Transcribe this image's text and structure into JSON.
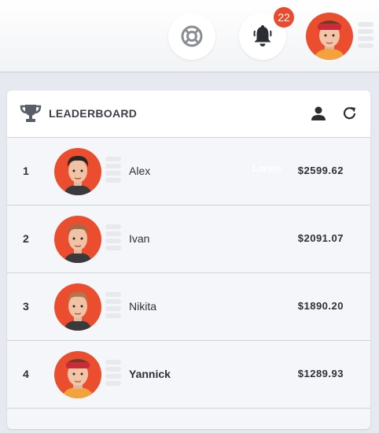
{
  "header": {
    "notification_count": "22",
    "icons": [
      "lifebuoy-icon",
      "bell-icon",
      "user-avatar"
    ]
  },
  "leaderboard": {
    "title": "LEADERBOARD",
    "rows": [
      {
        "rank": "1",
        "name": "Alex",
        "amount": "$2599.62",
        "ghost": "Lorem"
      },
      {
        "rank": "2",
        "name": "Ivan",
        "amount": "$2091.07"
      },
      {
        "rank": "3",
        "name": "Nikita",
        "amount": "$1890.20"
      },
      {
        "rank": "4",
        "name": "Yannick",
        "amount": "$1289.93"
      }
    ]
  },
  "colors": {
    "accent": "#ea4b2f",
    "background": "#e6e9f0"
  }
}
